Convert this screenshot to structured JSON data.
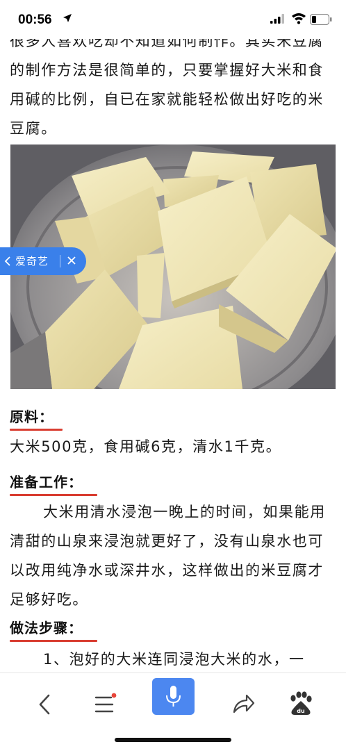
{
  "status_bar": {
    "time": "00:56",
    "icons": [
      "location-arrow-icon",
      "signal-icon",
      "wifi-icon",
      "battery-icon"
    ]
  },
  "article": {
    "intro_tail": "很多人喜欢吃却不知道如何制作。其实米豆腐的制作方法是很简单的，只要掌握好大米和食用碱的比例，自已在家就能轻松做出好吃的米豆腐。",
    "image_alt": "米豆腐",
    "ingredients_heading": "原料：",
    "ingredients_text": "大米500克，食用碱6克，清水1千克。",
    "prep_heading": "准备工作：",
    "prep_text": "大米用清水浸泡一晚上的时间，如果能用清甜的山泉来浸泡就更好了，没有山泉水也可以改用纯净水或深井水，这样做出的米豆腐才足够好吃。",
    "steps_heading": "做法步骤：",
    "step1_text": "1、泡好的大米连同浸泡大米的水，一"
  },
  "back_pill": {
    "label": "爱奇艺"
  },
  "toolbar": {
    "items": [
      "back-icon",
      "menu-icon",
      "mic-icon",
      "share-icon",
      "baidu-paw-icon"
    ],
    "accent": "#4c87f0",
    "badge_color": "#e8463a"
  },
  "colors": {
    "underline": "#d93d31",
    "pill": "#3a80ea"
  }
}
